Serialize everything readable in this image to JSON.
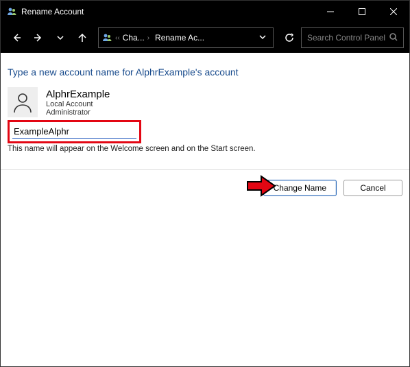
{
  "titlebar": {
    "title": "Rename Account"
  },
  "toolbar": {
    "breadcrumbs": {
      "seg1": "Cha...",
      "seg2": "Rename Ac..."
    },
    "search_placeholder": "Search Control Panel"
  },
  "page": {
    "heading": "Type a new account name for AlphrExample's account",
    "account": {
      "name": "AlphrExample",
      "type": "Local Account",
      "role": "Administrator"
    },
    "input_value": "ExampleAlphr",
    "hint": "This name will appear on the Welcome screen and on the Start screen.",
    "buttons": {
      "primary": "Change Name",
      "cancel": "Cancel"
    }
  }
}
